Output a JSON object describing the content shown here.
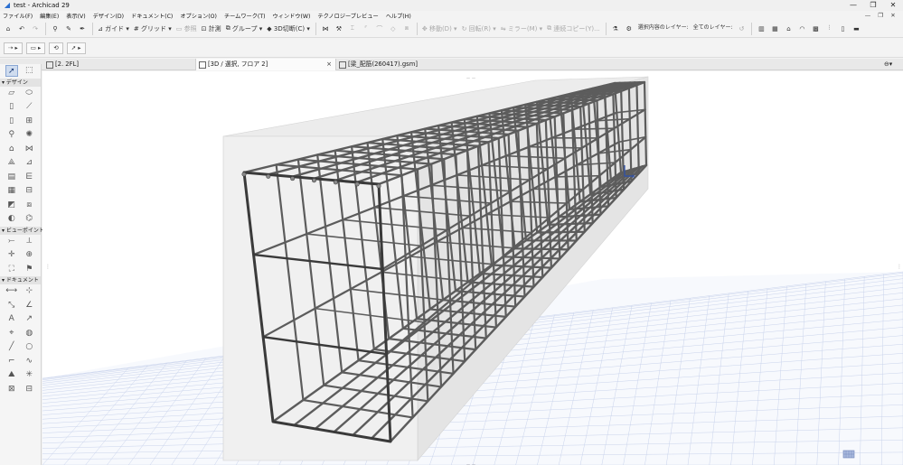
{
  "window": {
    "title": "test - Archicad 29",
    "controls": [
      "—",
      "❐",
      "✕"
    ]
  },
  "menu": {
    "items": [
      "ファイル(F)",
      "編集(E)",
      "表示(V)",
      "デザイン(D)",
      "ドキュメント(C)",
      "オプション(O)",
      "チームワーク(T)",
      "ウィンドウ(W)",
      "テクノロジープレビュー",
      "ヘルプ(H)"
    ],
    "right_controls": [
      "—",
      "❐",
      "✕"
    ]
  },
  "toolbar": {
    "guide_label": "ガイド",
    "grid_label": "グリッド",
    "reference_label": "参照",
    "measure_label": "計測",
    "group_label": "グループ",
    "cut3d_label": "3D切断(C)",
    "move_label": "移動(D)",
    "rotate_label": "回転(R)",
    "mirror_label": "ミラー(M)",
    "multiply_label": "連続コピー(Y)...",
    "layer_selected_label": "選択内容のレイヤー:",
    "layer_all_label": "全てのレイヤー:"
  },
  "tabs": [
    {
      "label": "[2. 2FL]"
    },
    {
      "label": "[3D / 選択, フロア 2]",
      "close": "×"
    },
    {
      "label": "[梁_配筋(260417).gsm]"
    }
  ],
  "toolbox": {
    "sections": [
      "デザイン",
      "ビューポイント",
      "ドキュメント"
    ]
  },
  "viewport": {
    "axis_label": "x",
    "colors": {
      "background": "#ffffff",
      "grid": "#c9d3ec",
      "concrete_light": "#f0f0f0",
      "concrete_side": "#e4e4e4",
      "rebar": "#5c5c5c",
      "rebar_dark": "#3a3a3a"
    }
  }
}
